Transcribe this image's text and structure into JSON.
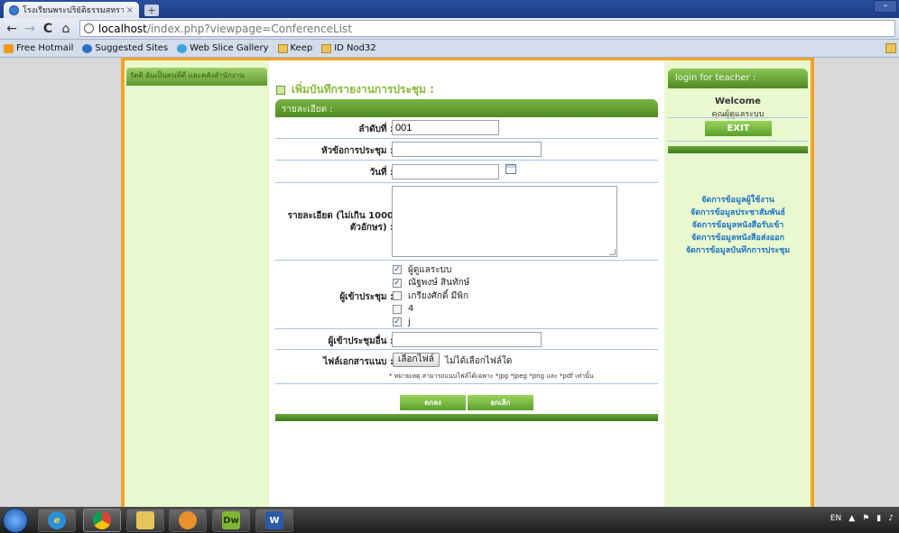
{
  "browser": {
    "tab_title": "โรงเรียนพระปริยัติธรรมสหราช",
    "tab_close": "×",
    "new_tab": "+",
    "minimize": "–",
    "url_host": "localhost",
    "url_path": "/index.php?viewpage=ConferenceList",
    "nav": {
      "back": "←",
      "forward": "→",
      "reload": "C",
      "home": "⌂"
    }
  },
  "bookmarks": [
    {
      "label": "Free Hotmail",
      "icon": "hotmail"
    },
    {
      "label": "Suggested Sites",
      "icon": "globe"
    },
    {
      "label": "Web Slice Gallery",
      "icon": "ie"
    },
    {
      "label": "Keep",
      "icon": "folder"
    },
    {
      "label": "ID Nod32",
      "icon": "folder"
    }
  ],
  "left": {
    "header": "รัตติ อันเป็นคนที่ดี และคลังสำนักงาน"
  },
  "main": {
    "title": "เพิ่มบันทึกรายงานการประชุม :",
    "section": "รายละเอียด :",
    "fields": {
      "order_label": "ลำดับที่ :",
      "order_value": "001",
      "topic_label": "หัวข้อการประชุม :",
      "topic_value": "",
      "date_label": "วันที่ :",
      "date_value": "",
      "detail_label": "รายละเอียด (ไม่เกิน 1000 ตัวอักษร) :",
      "attendees_label": "ผู้เข้าประชุม :",
      "other_label": "ผู้เข้าประชุมอื่น :",
      "other_value": "",
      "file_label": "ไฟล์เอกสารแนบ :",
      "file_button": "เลือกไฟล์",
      "file_status": "ไม่ได้เลือกไฟล์ใด"
    },
    "attendees": [
      {
        "name": "ผู้ดูแลระบบ",
        "checked": true
      },
      {
        "name": "ณัฐพงษ์ สินทักษ์",
        "checked": true
      },
      {
        "name": "เกรียงศักดิ์ มีพิก",
        "checked": false
      },
      {
        "name": "4",
        "checked": false
      },
      {
        "name": "j",
        "checked": true
      }
    ],
    "note": "* หมายเหตุ สามารถแนบไฟล์ได้เฉพาะ *jpg *jpeg *png และ *pdf เท่านั้น",
    "submit": "ตกลง",
    "cancel": "ยกเลิก"
  },
  "right": {
    "login_header": "login for teacher :",
    "welcome": "Welcome",
    "user": "คุณผู้ดูแลระบบ",
    "exit": "EXIT",
    "menu": [
      "จัดการข้อมูลผู้ใช้งาน",
      "จัดการข้อมูลประชาสัมพันธ์",
      "จัดการข้อมูลหนังสือรับเข้า",
      "จัดการข้อมูลหนังสือส่งออก",
      "จัดการข้อมูลบันทึกการประชุม"
    ]
  },
  "taskbar": {
    "items": [
      "ie",
      "chrome",
      "explorer",
      "media",
      "Dw",
      "W"
    ],
    "lang": "EN"
  }
}
